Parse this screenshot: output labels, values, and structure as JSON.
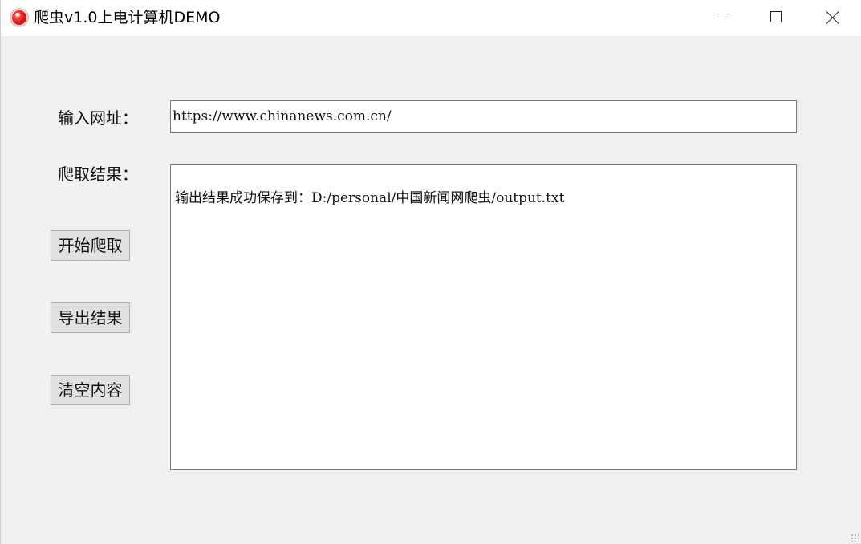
{
  "window": {
    "title": "爬虫v1.0上电计算机DEMO"
  },
  "form": {
    "url_label": "输入网址：",
    "url_value": "https://www.chinanews.com.cn/",
    "result_label": "爬取结果：",
    "result_text": "输出结果成功保存到：D:/personal/中国新闻网爬虫/output.txt"
  },
  "buttons": {
    "start": "开始爬取",
    "export": "导出结果",
    "clear": "清空内容"
  },
  "icons": {
    "app": "app-icon",
    "minimize": "minimize-icon",
    "maximize": "maximize-icon",
    "close": "close-icon"
  }
}
